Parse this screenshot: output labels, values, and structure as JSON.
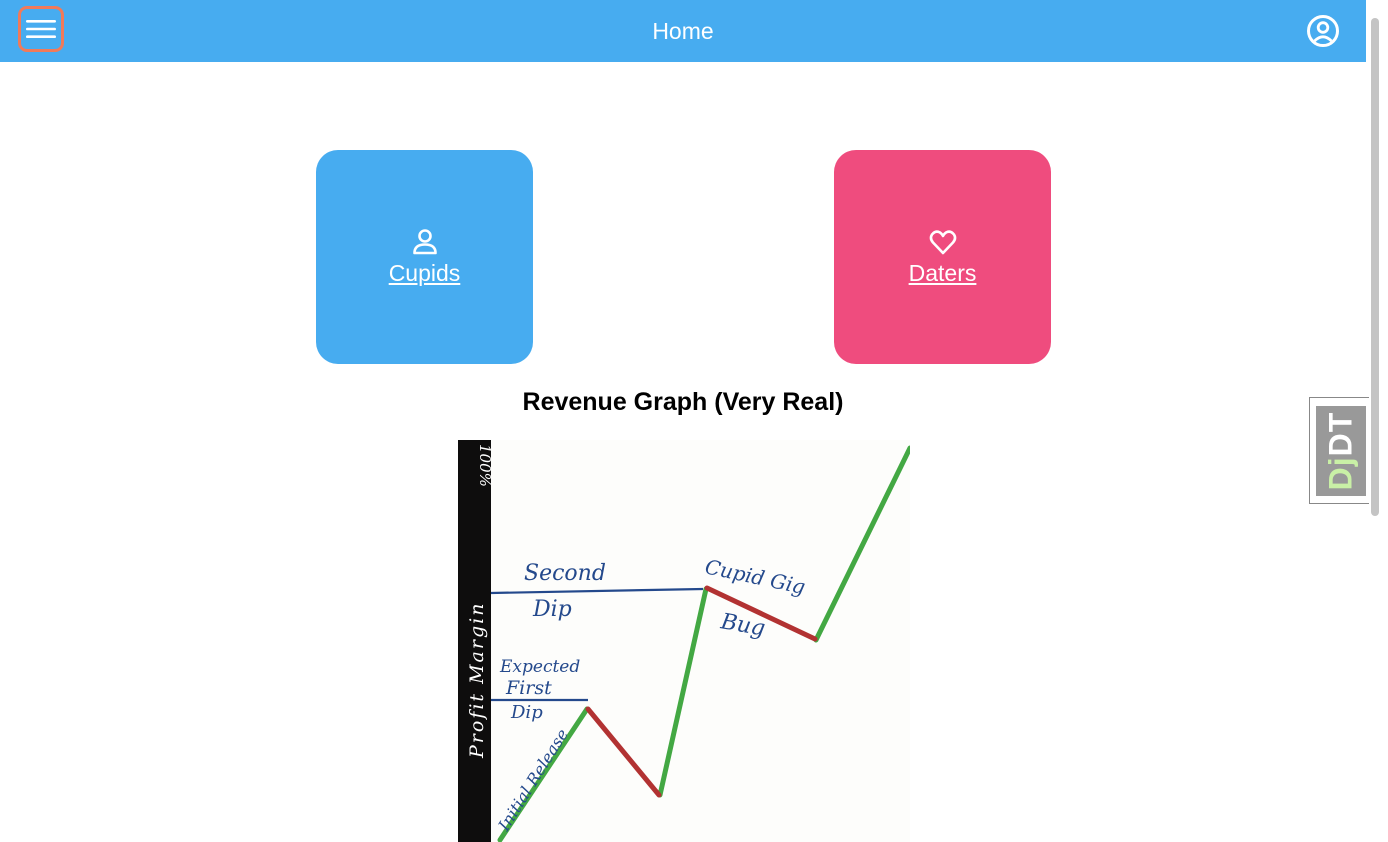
{
  "header": {
    "title": "Home",
    "menu_icon": "hamburger-icon",
    "account_icon": "user-circle-icon",
    "bar_color": "#47acf0",
    "menu_focus_color": "#f07a5a"
  },
  "cards": [
    {
      "label": "Cupids",
      "icon": "person-icon",
      "color": "#47acf0"
    },
    {
      "label": "Daters",
      "icon": "heart-icon",
      "color": "#ef4c7e"
    }
  ],
  "graph": {
    "title": "Revenue Graph (Very Real)",
    "y_axis_label": "Profit Margin",
    "y_axis_top_label": "100%",
    "annotations": {
      "initial_release": "Initial Release",
      "expected_first_dip": [
        "Expected",
        "First",
        "Dip"
      ],
      "second_dip": [
        "Second",
        "Dip"
      ],
      "cupid_gig_bug": [
        "Cupid Gig",
        "Bug"
      ]
    },
    "colors": {
      "rise": "#43a843",
      "dip": "#b23232",
      "annotation": "#24498c",
      "axis": "#0e0d0d"
    }
  },
  "debug_toolbar": {
    "label_dj": "Dj",
    "label_dt": "DT"
  }
}
